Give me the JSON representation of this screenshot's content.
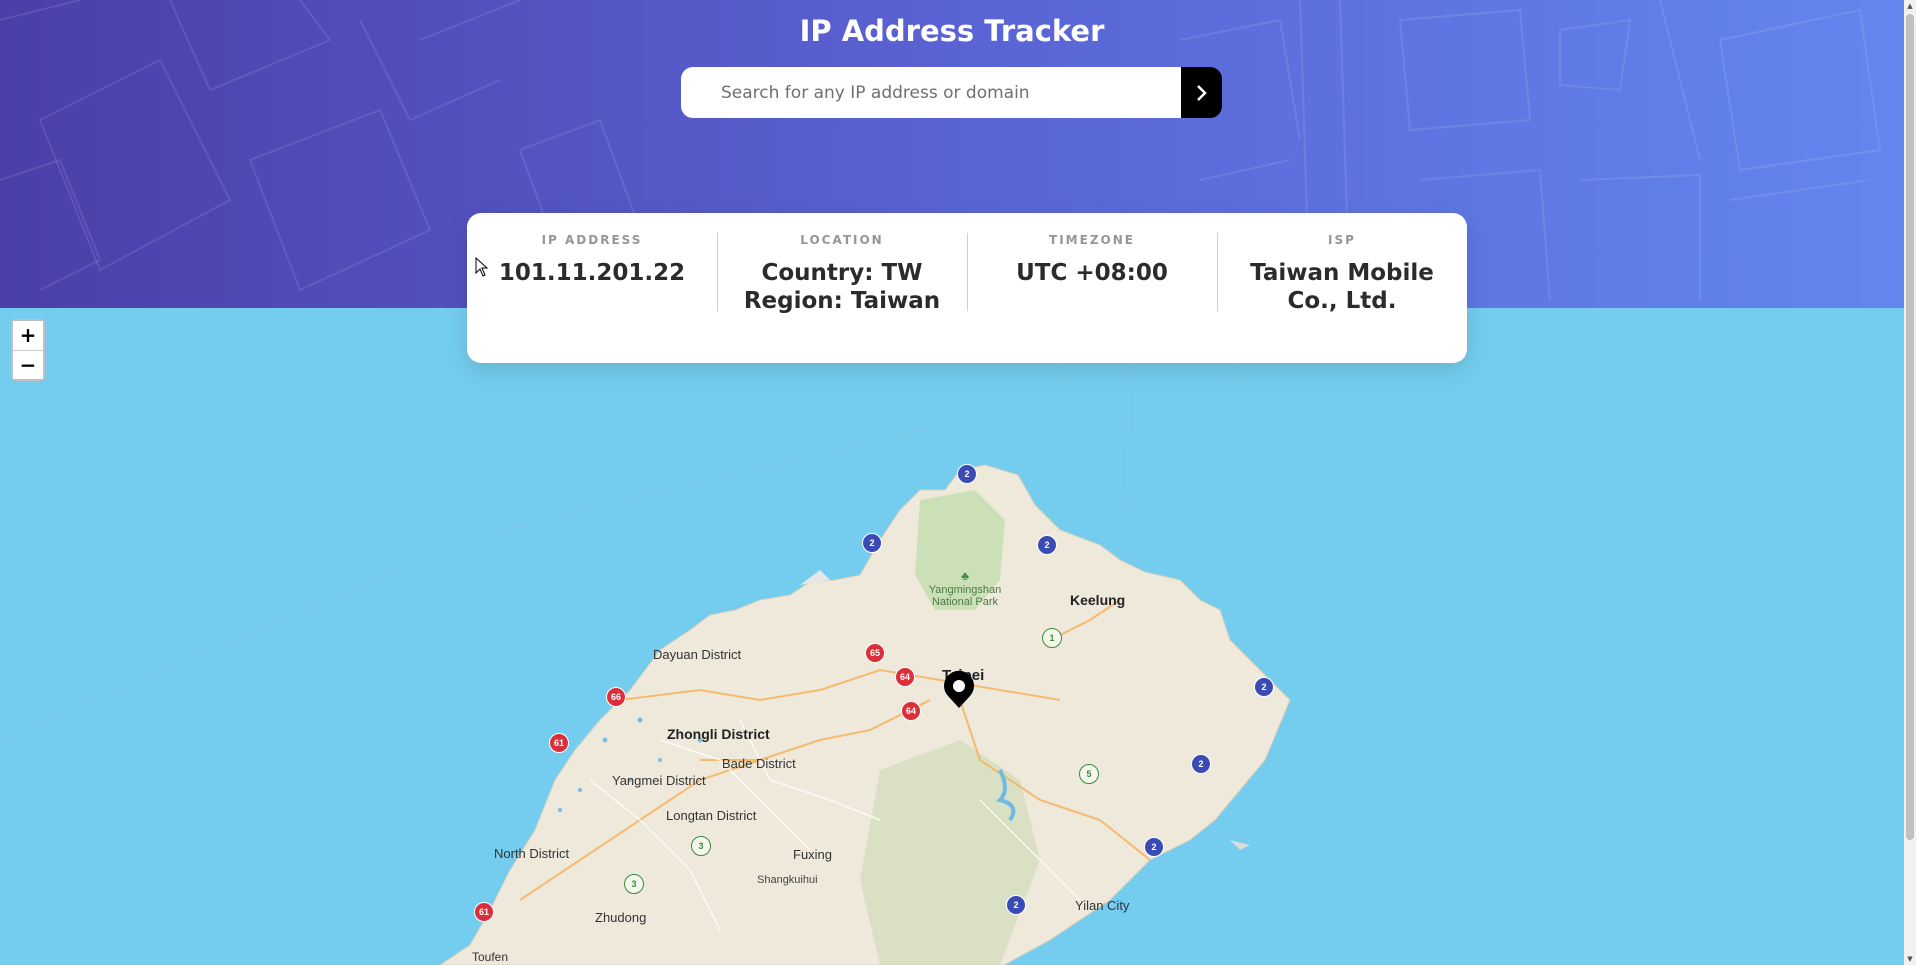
{
  "header": {
    "title": "IP Address Tracker",
    "search_placeholder": "Search for any IP address or domain",
    "submit_icon": "chevron-right-icon"
  },
  "stats": [
    {
      "label": "IP ADDRESS",
      "value": "101.11.201.22"
    },
    {
      "label": "LOCATION",
      "value": "Country: TW Region: Taiwan"
    },
    {
      "label": "TIMEZONE",
      "value": "UTC +08:00"
    },
    {
      "label": "ISP",
      "value": "Taiwan Mobile Co., Ltd."
    }
  ],
  "map": {
    "zoom_in": "+",
    "zoom_out": "−",
    "marker_icon": "location-marker-icon",
    "park_label": [
      "Yangmingshan",
      "National Park"
    ],
    "places": [
      "Keelung",
      "Taipei",
      "Dayuan District",
      "Zhongli District",
      "Bade District",
      "Yangmei District",
      "Longtan District",
      "North District",
      "Fuxing",
      "Shangkuihui",
      "Zhudong",
      "Toufen",
      "Yilan City"
    ],
    "roads": [
      "2",
      "2",
      "2",
      "2",
      "2",
      "2",
      "2",
      "1",
      "5",
      "3",
      "3",
      "61",
      "61",
      "65",
      "64",
      "64",
      "66"
    ]
  },
  "colors": {
    "header_gradient_start": "#4a3fa8",
    "header_gradient_end": "#6287ee",
    "sea": "#74cdee",
    "land": "#efe9dc",
    "button": "#000000"
  }
}
